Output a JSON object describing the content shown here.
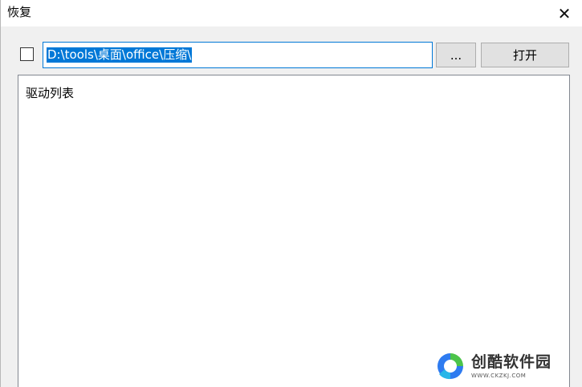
{
  "window": {
    "title": "恢复",
    "close_glyph": "✕"
  },
  "toolbar": {
    "path_value": "D:\\tools\\桌面\\office\\压缩\\",
    "browse_label": "...",
    "open_label": "打开"
  },
  "drive_list": {
    "label": "驱动列表"
  },
  "watermark": {
    "name": "创酷软件园",
    "url": "WWW.CKZKJ.COM",
    "colors": {
      "blue": "#2e7bf0",
      "green": "#4cc44a",
      "cyan": "#29b6e8"
    }
  },
  "colors": {
    "accent": "#0078d7",
    "button_bg": "#e1e1e1",
    "window_bg": "#f0f0f0"
  }
}
